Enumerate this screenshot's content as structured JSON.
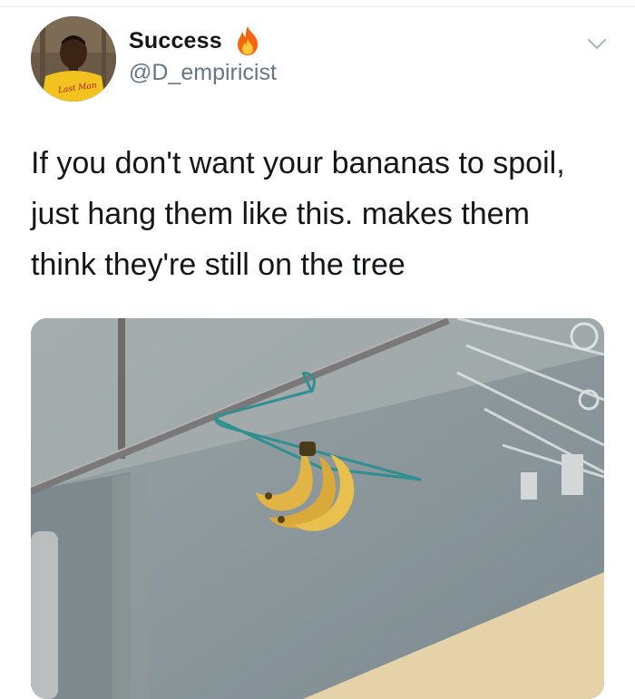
{
  "author": {
    "display_name": "Success",
    "handle": "@D_empiricist",
    "badge_icon": "fire-icon",
    "avatar_shirt_text": "Last Man"
  },
  "menu_icon": "chevron-down-icon",
  "tweet": {
    "lines": [
      "If you don't want your bananas to spoil,",
      "just hang them like this.  makes them",
      "think they're still on the tree"
    ]
  },
  "media": {
    "subject": "photo",
    "colors": {
      "wall": "#8d999e",
      "banana": "#e0b545",
      "hanger": "#2f8f91",
      "pole": "#8a8a8a"
    }
  }
}
